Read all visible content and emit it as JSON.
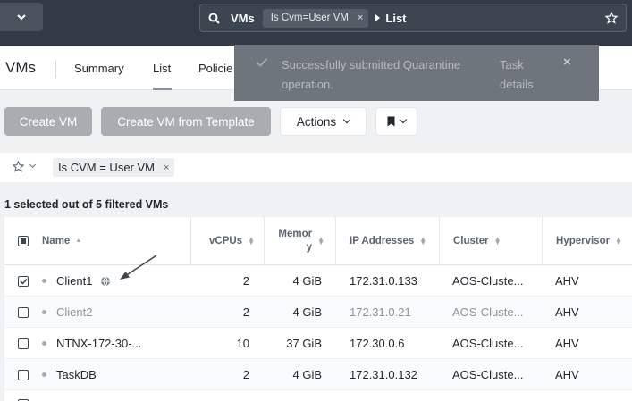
{
  "search": {
    "entity": "VMs",
    "chip": "Is Cvm=User VM",
    "chip_close": "×",
    "view": "List"
  },
  "nav": {
    "title": "VMs",
    "tabs": [
      {
        "label": "Summary"
      },
      {
        "label": "List"
      },
      {
        "label": "Policie"
      }
    ]
  },
  "toast": {
    "message": "Successfully submitted Quarantine operation.",
    "link": "Task details.",
    "close": "×"
  },
  "toolbar": {
    "create_vm": "Create VM",
    "create_from_template": "Create VM from Template",
    "actions": "Actions"
  },
  "filter": {
    "chip": "Is CVM = User VM",
    "chip_close": "×"
  },
  "selection_info": "1 selected out of 5 filtered VMs",
  "table": {
    "columns": {
      "name": "Name",
      "vcpus": "vCPUs",
      "memory_line1": "Memor",
      "memory_line2": "y",
      "ip": "IP Addresses",
      "cluster": "Cluster",
      "hypervisor": "Hypervisor"
    },
    "rows": [
      {
        "name": "Client1",
        "vcpus": "2",
        "memory": "4 GiB",
        "ip": "172.31.0.133",
        "cluster": "AOS-Cluste...",
        "hypervisor": "AHV",
        "checked": true,
        "muted": false
      },
      {
        "name": "Client2",
        "vcpus": "2",
        "memory": "4 GiB",
        "ip": "172.31.0.21",
        "cluster": "AOS-Cluste...",
        "hypervisor": "AHV",
        "checked": false,
        "muted": true
      },
      {
        "name": "NTNX-172-30-...",
        "vcpus": "10",
        "memory": "37 GiB",
        "ip": "172.30.0.6",
        "cluster": "AOS-Cluste...",
        "hypervisor": "AHV",
        "checked": false,
        "muted": false
      },
      {
        "name": "TaskDB",
        "vcpus": "2",
        "memory": "4 GiB",
        "ip": "172.31.0.132",
        "cluster": "AOS-Cluste...",
        "hypervisor": "AHV",
        "checked": false,
        "muted": false
      }
    ]
  },
  "colors": {
    "topbar": "#323a45",
    "toast": "#6f757c",
    "primary_button": "#a9adb2"
  }
}
